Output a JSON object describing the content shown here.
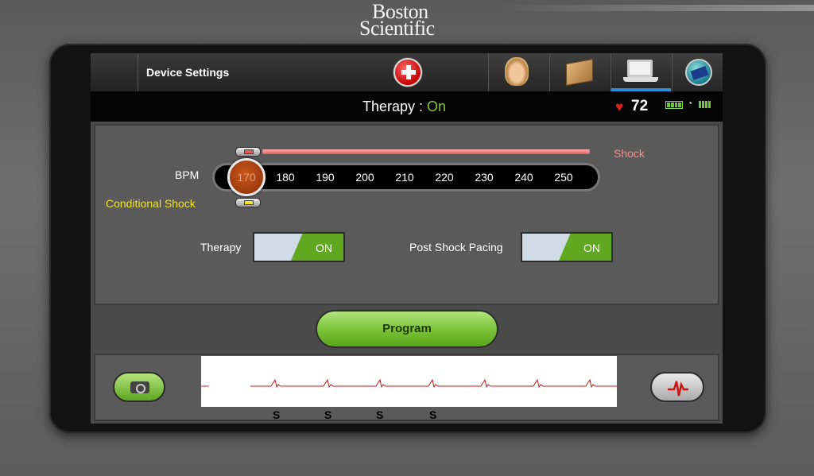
{
  "brand": {
    "line1": "Boston",
    "line2": "Scientific"
  },
  "header": {
    "title": "Device Settings",
    "nav": [
      {
        "name": "patient",
        "icon": "patient-icon"
      },
      {
        "name": "box",
        "icon": "package-icon"
      },
      {
        "name": "device",
        "icon": "laptop-icon",
        "active": true
      },
      {
        "name": "network",
        "icon": "globe-icon"
      }
    ]
  },
  "status": {
    "therapy_label": "Therapy : ",
    "therapy_value": "On",
    "heart_rate": "72"
  },
  "zones": {
    "shock_label": "Shock",
    "conditional_label": "Conditional Shock",
    "bpm_label": "BPM",
    "bpm_selected": "170",
    "bpm_ticks": [
      "180",
      "190",
      "200",
      "210",
      "220",
      "230",
      "240",
      "250"
    ]
  },
  "toggles": {
    "therapy": {
      "label": "Therapy",
      "value": "ON"
    },
    "post_shock": {
      "label": "Post Shock Pacing",
      "value": "ON"
    }
  },
  "program_button": "Program",
  "ecg": {
    "markers": [
      "S",
      "S",
      "S",
      "S"
    ]
  },
  "colors": {
    "accent_green": "#7cc43a",
    "shock_red": "#e05a5a",
    "conditional_yellow": "#f2e323"
  }
}
